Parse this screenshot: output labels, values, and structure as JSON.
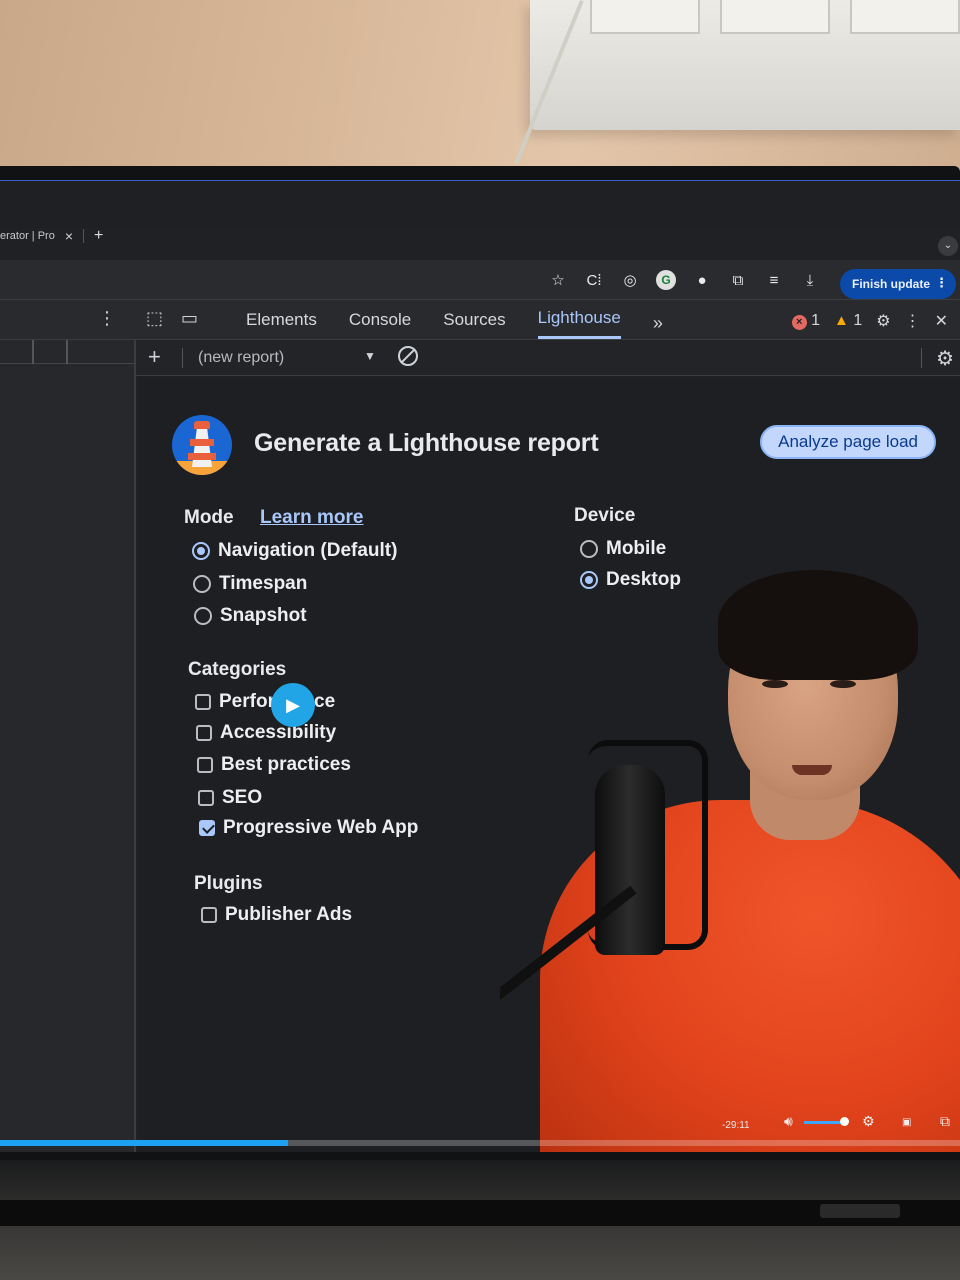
{
  "browser": {
    "tab_title": "erator | Pro",
    "tab_close": "×",
    "new_tab": "+",
    "finish_update": "Finish update"
  },
  "devtools": {
    "tabs": [
      "Elements",
      "Console",
      "Sources",
      "Lighthouse"
    ],
    "active_tab": "Lighthouse",
    "error_count": "1",
    "warning_count": "1"
  },
  "lighthouse": {
    "report_select": "(new report)",
    "title": "Generate a Lighthouse report",
    "analyze_button": "Analyze page load",
    "mode": {
      "label": "Mode",
      "learn_more": "Learn more",
      "options": [
        "Navigation (Default)",
        "Timespan",
        "Snapshot"
      ],
      "selected": "Navigation (Default)"
    },
    "device": {
      "label": "Device",
      "options": [
        "Mobile",
        "Desktop"
      ],
      "selected": "Desktop"
    },
    "categories": {
      "label": "Categories",
      "items": [
        "Performance",
        "Accessibility",
        "Best practices",
        "SEO",
        "Progressive Web App"
      ],
      "checked": [
        "Progressive Web App"
      ]
    },
    "plugins": {
      "label": "Plugins",
      "items": [
        "Publisher Ads"
      ]
    }
  },
  "video": {
    "time_remaining": "-29:11",
    "progress_fraction": 0.3,
    "play_color": "#22a5e6"
  },
  "colors": {
    "accent": "#a8c7fa",
    "finish_button": "#0b4aa8",
    "error": "#e46962",
    "warning": "#f9ab00"
  }
}
